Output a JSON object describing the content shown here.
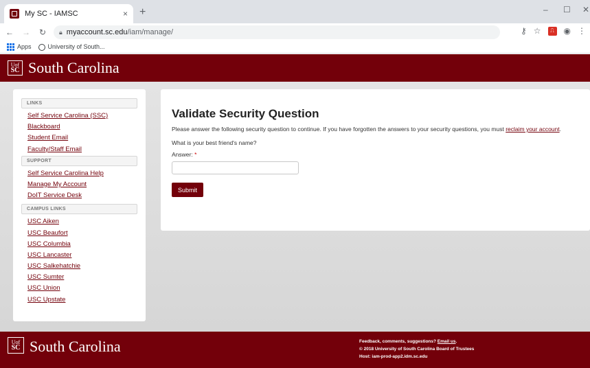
{
  "browser": {
    "tab_title": "My SC - IAMSC",
    "tab_close": "×",
    "new_tab": "+",
    "minimize": "–",
    "maximize": "☐",
    "close": "✕",
    "url_host": "myaccount.sc.edu",
    "url_path": "/iam/manage/",
    "bookmarks": [
      "Apps",
      "University of South..."
    ]
  },
  "header": {
    "logo_top": "Uof",
    "logo_bottom": "SC",
    "name": "South Carolina"
  },
  "sidebar": {
    "links_heading": "LINKS",
    "links": [
      "Self Service Carolina (SSC)",
      "Blackboard",
      "Student Email",
      "Faculty/Staff Email"
    ],
    "support_heading": "SUPPORT",
    "support": [
      "Self Service Carolina Help",
      "Manage My Account",
      "DoIT Service Desk"
    ],
    "campus_heading": "CAMPUS LINKS",
    "campus": [
      "USC Aiken",
      "USC Beaufort",
      "USC Columbia",
      "USC Lancaster",
      "USC Salkehatchie",
      "USC Sumter",
      "USC Union",
      "USC Upstate"
    ]
  },
  "main": {
    "title": "Validate Security Question",
    "text_before": "Please answer the following security question to continue. If you have forgotten the answers to your security questions, you must ",
    "reclaim_link": "reclaim your account",
    "text_after": ".",
    "question": "What is your best friend's name?",
    "answer_label": "Answer:",
    "required_mark": "*",
    "answer_value": "",
    "submit_label": "Submit"
  },
  "footer": {
    "feedback_text": "Feedback, comments, suggestions? ",
    "email_link": "Email us",
    "feedback_end": ".",
    "copyright": "© 2018 University of South Carolina Board of Trustees",
    "host": "Host: iam-prod-app2.idm.sc.edu"
  },
  "colors": {
    "garnet": "#73000a",
    "page_bg": "#dddddd"
  }
}
